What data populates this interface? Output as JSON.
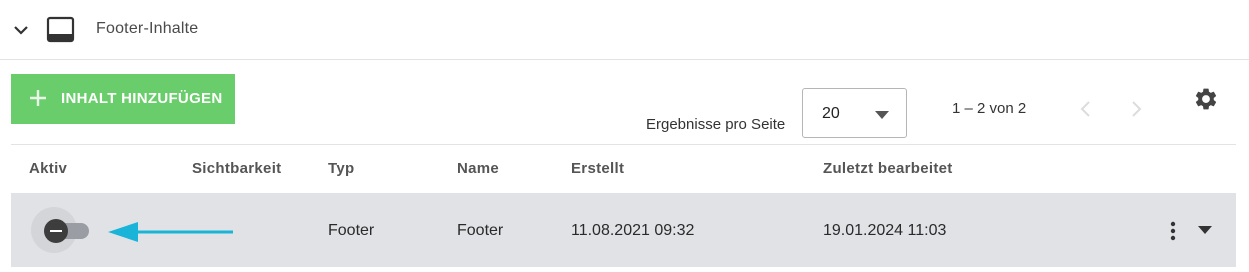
{
  "section": {
    "title": "Footer-Inhalte",
    "chevron_icon": "chevron-down-icon",
    "window_icon": "window-icon"
  },
  "toolbar": {
    "add_label": "INHALT HINZUFÜGEN",
    "add_icon": "plus-icon",
    "per_page_label": "Ergebnisse pro Seite",
    "per_page_value": "20",
    "range_text": "1 – 2 von 2",
    "settings_icon": "gear-icon"
  },
  "table": {
    "headers": [
      "Aktiv",
      "Sichtbarkeit",
      "Typ",
      "Name",
      "Erstellt",
      "Zuletzt bearbeitet"
    ],
    "rows": [
      {
        "active": false,
        "visibility": "",
        "type": "Footer",
        "name": "Footer",
        "created": "11.08.2021 09:32",
        "modified": "19.01.2024 11:03"
      }
    ]
  },
  "colors": {
    "accent_green": "#6acd6b",
    "row_bg": "#e0e2e6",
    "annotation_arrow": "#1ab4d8"
  }
}
